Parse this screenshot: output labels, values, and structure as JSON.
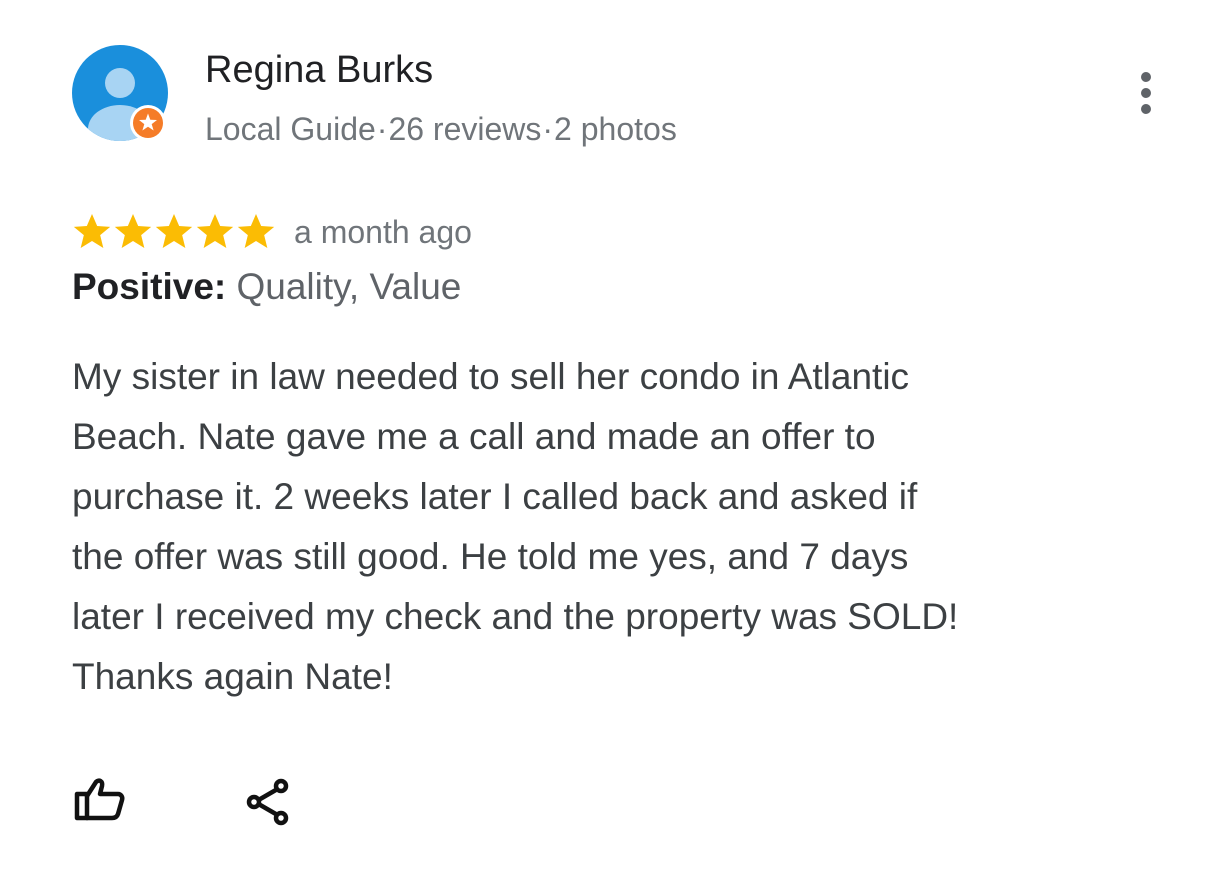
{
  "reviewer": {
    "name": "Regina Burks",
    "badge": "Local Guide",
    "reviews": "26 reviews",
    "photos": "2 photos",
    "separator": "·",
    "avatar_icon": "person-avatar-icon",
    "badge_icon": "local-guide-star-icon"
  },
  "review": {
    "rating": 5,
    "max_rating": 5,
    "date": "a month ago",
    "highlights_label": "Positive:",
    "highlights_values": "Quality, Value",
    "text_lines": [
      "My sister in law needed to sell her condo in Atlantic",
      "Beach. Nate gave me a call and made an offer to",
      "purchase it. 2 weeks later I called back and asked if",
      "the offer was still good. He told me yes, and 7 days",
      "later I received my check and the property was SOLD!",
      "Thanks again Nate!"
    ]
  },
  "actions": {
    "like_icon": "thumbs-up-icon",
    "share_icon": "share-icon",
    "more_icon": "more-vertical-icon"
  },
  "colors": {
    "star": "#fbbc04",
    "avatar_bg": "#1a8fdc",
    "avatar_figure": "#a8d4f3",
    "badge": "#f57c28",
    "name": "#202124",
    "meta": "#70757a",
    "body": "#3c4043"
  }
}
